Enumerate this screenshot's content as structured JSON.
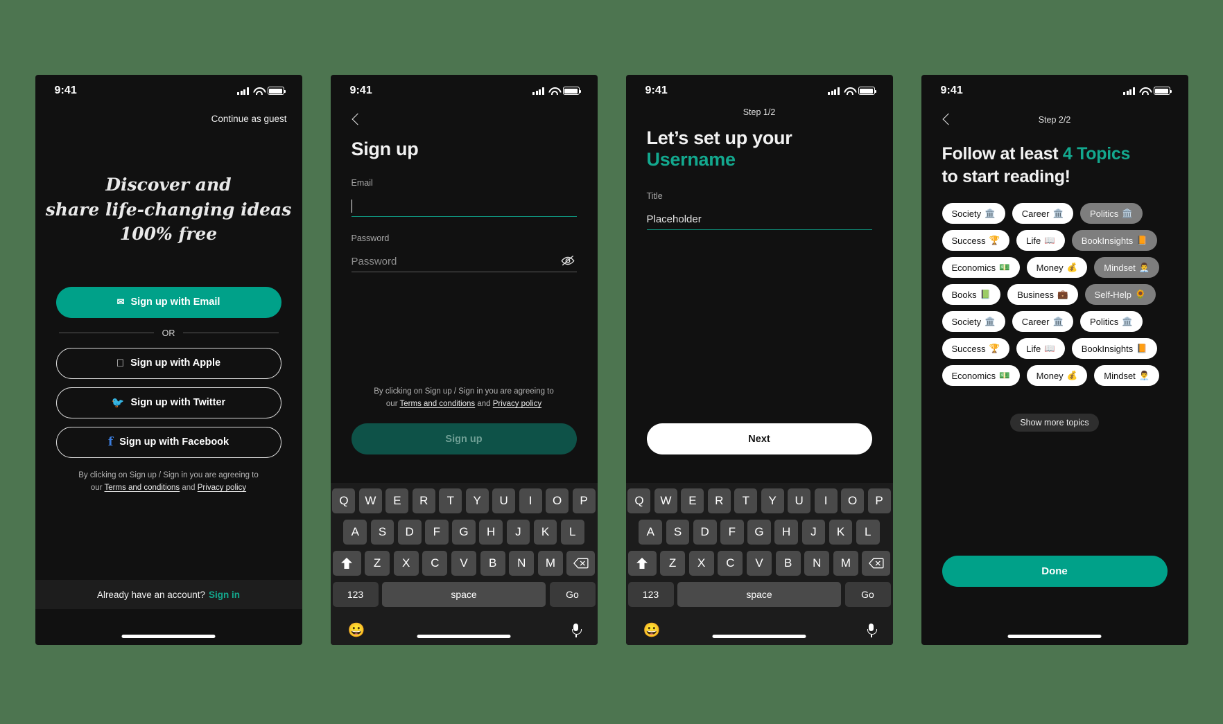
{
  "theme": {
    "page_bg": "#4d7550",
    "screen_bg": "#111111",
    "accent_teal": "#00a189",
    "accent_teal_text": "#13a88e",
    "signup_disabled_bg": "#0e5248"
  },
  "status_bar": {
    "time": "9:41",
    "signal_icon": "signal-icon",
    "wifi_icon": "wifi-icon",
    "battery_icon": "battery-icon"
  },
  "screen1": {
    "guest_link": "Continue as guest",
    "hero_lines": [
      "Discover and",
      "share life-changing ideas",
      "100% free"
    ],
    "primary_button": {
      "label": "Sign up with Email",
      "icon": "envelope-icon"
    },
    "divider_text": "OR",
    "social_buttons": [
      {
        "label": "Sign up with Apple",
        "icon": "apple-icon"
      },
      {
        "label": "Sign up with Twitter",
        "icon": "twitter-icon"
      },
      {
        "label": "Sign up with Facebook",
        "icon": "facebook-icon"
      }
    ],
    "legal": {
      "line1": "By clicking on Sign up / Sign in you are agreeing to",
      "prefix": "our ",
      "terms": "Terms and conditions",
      "middle": " and ",
      "privacy": "Privacy policy"
    },
    "footer": {
      "text": "Already have an account?",
      "link": "Sign in"
    }
  },
  "screen2": {
    "back_icon": "back-chevron-icon",
    "title": "Sign up",
    "email": {
      "label": "Email",
      "value": ""
    },
    "password": {
      "label": "Password",
      "placeholder": "Password",
      "toggle_icon": "eye-off-icon"
    },
    "legal": {
      "line1": "By clicking on Sign up / Sign in you are agreeing to",
      "prefix": "our ",
      "terms": "Terms and conditions",
      "middle": " and ",
      "privacy": "Privacy policy"
    },
    "submit_label": "Sign up"
  },
  "screen3": {
    "step": "Step 1/2",
    "title_line1": "Let’s set up your",
    "title_line2": "Username",
    "field": {
      "label": "Title",
      "value": "Placeholder"
    },
    "next_label": "Next"
  },
  "screen4": {
    "back_icon": "back-chevron-icon",
    "step": "Step 2/2",
    "title_pre": "Follow at least ",
    "title_highlight": "4 Topics",
    "title_post": "to start reading!",
    "topics": [
      {
        "label": "Society",
        "emoji": "🏛️",
        "selected": true
      },
      {
        "label": "Career",
        "emoji": "🏛️",
        "selected": true
      },
      {
        "label": "Politics",
        "emoji": "🏛️",
        "selected": false
      },
      {
        "label": "Success",
        "emoji": "🏆",
        "selected": true
      },
      {
        "label": "Life",
        "emoji": "📖",
        "selected": true
      },
      {
        "label": "BookInsights",
        "emoji": "📙",
        "selected": false
      },
      {
        "label": "Economics",
        "emoji": "💵",
        "selected": true
      },
      {
        "label": "Money",
        "emoji": "💰",
        "selected": true
      },
      {
        "label": "Mindset",
        "emoji": "👨‍💼",
        "selected": false
      },
      {
        "label": "Books",
        "emoji": "📗",
        "selected": true
      },
      {
        "label": "Business",
        "emoji": "💼",
        "selected": true
      },
      {
        "label": "Self-Help",
        "emoji": "🌻",
        "selected": false
      },
      {
        "label": "Society",
        "emoji": "🏛️",
        "selected": true
      },
      {
        "label": "Career",
        "emoji": "🏛️",
        "selected": true
      },
      {
        "label": "Politics",
        "emoji": "🏛️",
        "selected": true
      },
      {
        "label": "Success",
        "emoji": "🏆",
        "selected": true
      },
      {
        "label": "Life",
        "emoji": "📖",
        "selected": true
      },
      {
        "label": "BookInsights",
        "emoji": "📙",
        "selected": true
      },
      {
        "label": "Economics",
        "emoji": "💵",
        "selected": true
      },
      {
        "label": "Money",
        "emoji": "💰",
        "selected": true
      },
      {
        "label": "Mindset",
        "emoji": "👨‍💼",
        "selected": true
      }
    ],
    "show_more_label": "Show more topics",
    "done_label": "Done"
  },
  "keyboard": {
    "row1": [
      "Q",
      "W",
      "E",
      "R",
      "T",
      "Y",
      "U",
      "I",
      "O",
      "P"
    ],
    "row2": [
      "A",
      "S",
      "D",
      "F",
      "G",
      "H",
      "J",
      "K",
      "L"
    ],
    "row3": [
      "Z",
      "X",
      "C",
      "V",
      "B",
      "N",
      "M"
    ],
    "shift_icon": "shift-icon",
    "delete_icon": "backspace-icon",
    "numeric_label": "123",
    "space_label": "space",
    "return_label": "Go",
    "emoji_icon": "emoji-icon",
    "mic_icon": "microphone-icon"
  }
}
